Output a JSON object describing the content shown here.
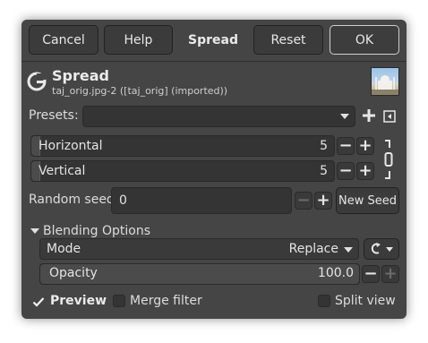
{
  "header": {
    "cancel_label": "Cancel",
    "help_label": "Help",
    "title": "Spread",
    "reset_label": "Reset",
    "ok_label": "OK"
  },
  "filter": {
    "name": "Spread",
    "source": "taj_orig.jpg-2 ([taj_orig] (imported))",
    "logo_letter": "G"
  },
  "presets": {
    "label": "Presets:",
    "value": ""
  },
  "horizontal": {
    "label": "Horizontal",
    "value": "5"
  },
  "vertical": {
    "label": "Vertical",
    "value": "5"
  },
  "random_seed": {
    "label": "Random seed",
    "value": "0",
    "new_seed_label": "New Seed"
  },
  "blending": {
    "section_label": "Blending Options",
    "mode_label": "Mode",
    "mode_value": "Replace",
    "opacity_label": "Opacity",
    "opacity_value": "100.0"
  },
  "footer": {
    "preview_label": "Preview",
    "preview_checked": true,
    "merge_label": "Merge filter",
    "merge_checked": false,
    "split_label": "Split view",
    "split_checked": false
  },
  "colors": {
    "dialog_bg": "#454545",
    "field_bg": "#343434",
    "text": "#dcdcdc"
  }
}
